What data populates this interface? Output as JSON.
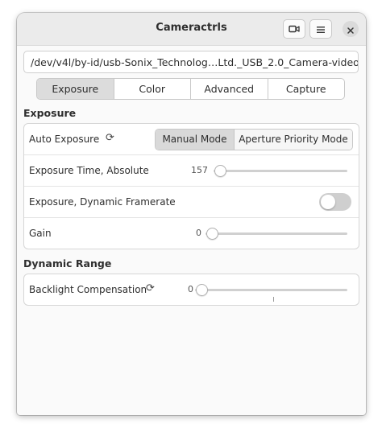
{
  "window": {
    "title": "Cameractrls",
    "icons": {
      "camera": "video-camera-icon",
      "menu": "hamburger-menu-icon",
      "close": "close-icon"
    }
  },
  "device": {
    "selected": "/dev/v4l/by-id/usb-Sonix_Technolog…Ltd._USB_2.0_Camera-video-index0"
  },
  "tabs": [
    {
      "label": "Exposure",
      "active": true
    },
    {
      "label": "Color",
      "active": false
    },
    {
      "label": "Advanced",
      "active": false
    },
    {
      "label": "Capture",
      "active": false
    }
  ],
  "sections": {
    "exposure": {
      "title": "Exposure",
      "auto_exposure": {
        "label": "Auto Exposure",
        "reset_icon": "reset-icon",
        "options": [
          "Manual Mode",
          "Aperture Priority Mode"
        ],
        "selected": "Manual Mode"
      },
      "exposure_time": {
        "label": "Exposure Time, Absolute",
        "value": "157",
        "fraction": 0.0
      },
      "dynamic_framerate": {
        "label": "Exposure, Dynamic Framerate",
        "on": false
      },
      "gain": {
        "label": "Gain",
        "value": "0",
        "fraction": 0.0
      }
    },
    "dynamic_range": {
      "title": "Dynamic Range",
      "backlight": {
        "label": "Backlight Compensation",
        "reset_icon": "reset-icon",
        "value": "0",
        "fraction": 0.0
      }
    }
  },
  "colors": {
    "titlebar": "#ebebeb",
    "active_tab": "#dcdcdc",
    "switch_off": "#cfcfcf"
  }
}
